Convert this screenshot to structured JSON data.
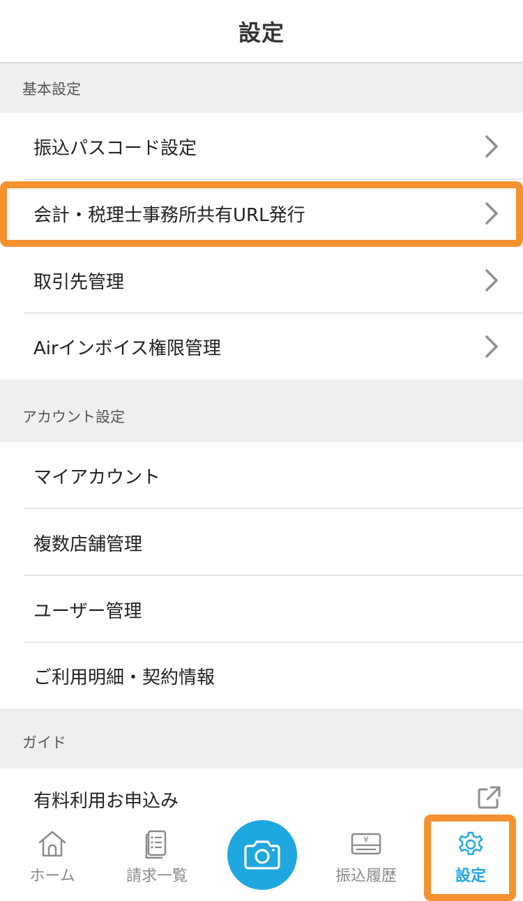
{
  "header": {
    "title": "設定"
  },
  "sections": [
    {
      "title": "基本設定",
      "items": [
        {
          "label": "振込パスコード設定"
        },
        {
          "label": "会計・税理士事務所共有URL発行"
        },
        {
          "label": "取引先管理"
        },
        {
          "label": "Airインボイス権限管理"
        }
      ]
    },
    {
      "title": "アカウント設定",
      "items": [
        {
          "label": "マイアカウント"
        },
        {
          "label": "複数店舗管理"
        },
        {
          "label": "ユーザー管理"
        },
        {
          "label": "ご利用明細・契約情報"
        }
      ]
    },
    {
      "title": "ガイド",
      "items": [
        {
          "label": "有料利用お申込み",
          "icon": "external-link-icon"
        }
      ]
    }
  ],
  "tabbar": {
    "tabs": [
      {
        "label": "ホーム",
        "icon": "home-icon"
      },
      {
        "label": "請求一覧",
        "icon": "invoice-list-icon"
      },
      {
        "label": "",
        "icon": "camera-icon"
      },
      {
        "label": "振込履歴",
        "icon": "transfer-history-icon"
      },
      {
        "label": "設定",
        "icon": "gear-icon",
        "active": true
      }
    ]
  },
  "colors": {
    "accent": "#1ea8df",
    "highlight": "#f5922f",
    "section_bg": "#efefef"
  }
}
